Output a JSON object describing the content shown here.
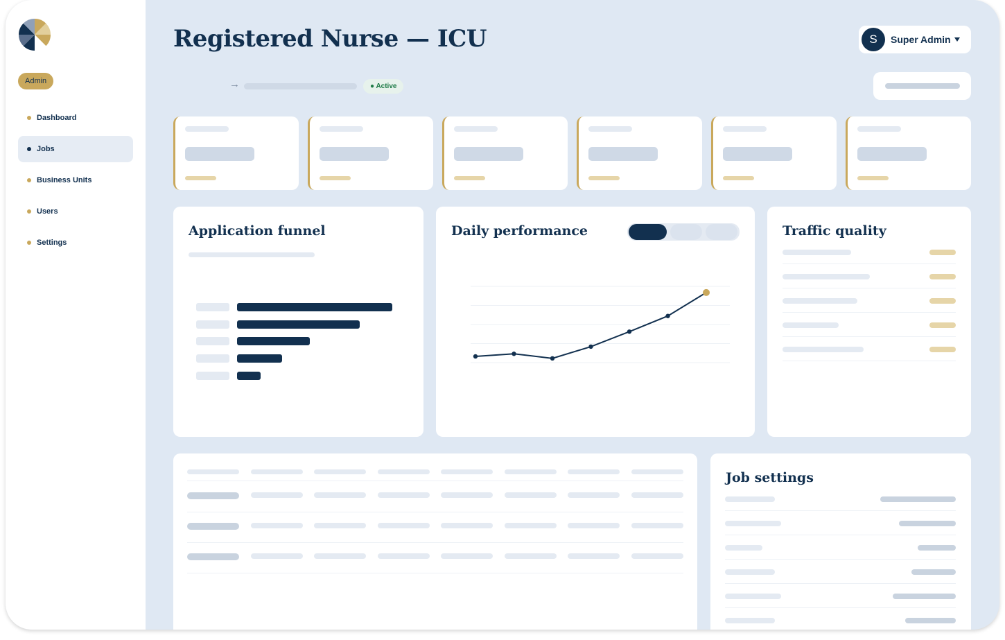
{
  "sidebar": {
    "logo_icon": "pinwheel-logo-icon",
    "role_badge": "Admin",
    "items": [
      {
        "label": "Dashboard",
        "active": false
      },
      {
        "label": "Jobs",
        "active": true
      },
      {
        "label": "Business Units",
        "active": false
      },
      {
        "label": "Users",
        "active": false
      },
      {
        "label": "Settings",
        "active": false
      }
    ]
  },
  "header": {
    "title": "Registered Nurse — ICU",
    "user": {
      "initial": "S",
      "name": "Super Admin",
      "menu_icon": "caret-down-icon"
    },
    "status": "● Active",
    "arrow_icon": "arrow-right-icon"
  },
  "panels": {
    "funnel": {
      "title": "Application funnel",
      "bars": [
        1.0,
        0.79,
        0.47,
        0.29,
        0.15
      ]
    },
    "daily": {
      "title": "Daily performance",
      "points": [
        0.0,
        0.04,
        -0.03,
        0.15,
        0.38,
        0.62,
        0.98
      ]
    },
    "traffic": {
      "title": "Traffic quality"
    },
    "settings": {
      "title": "Job settings"
    }
  },
  "colors": {
    "navy": "#12304f",
    "gold": "#c9a85c",
    "background": "#dfe8f3",
    "active_green": "#1d7a46"
  }
}
